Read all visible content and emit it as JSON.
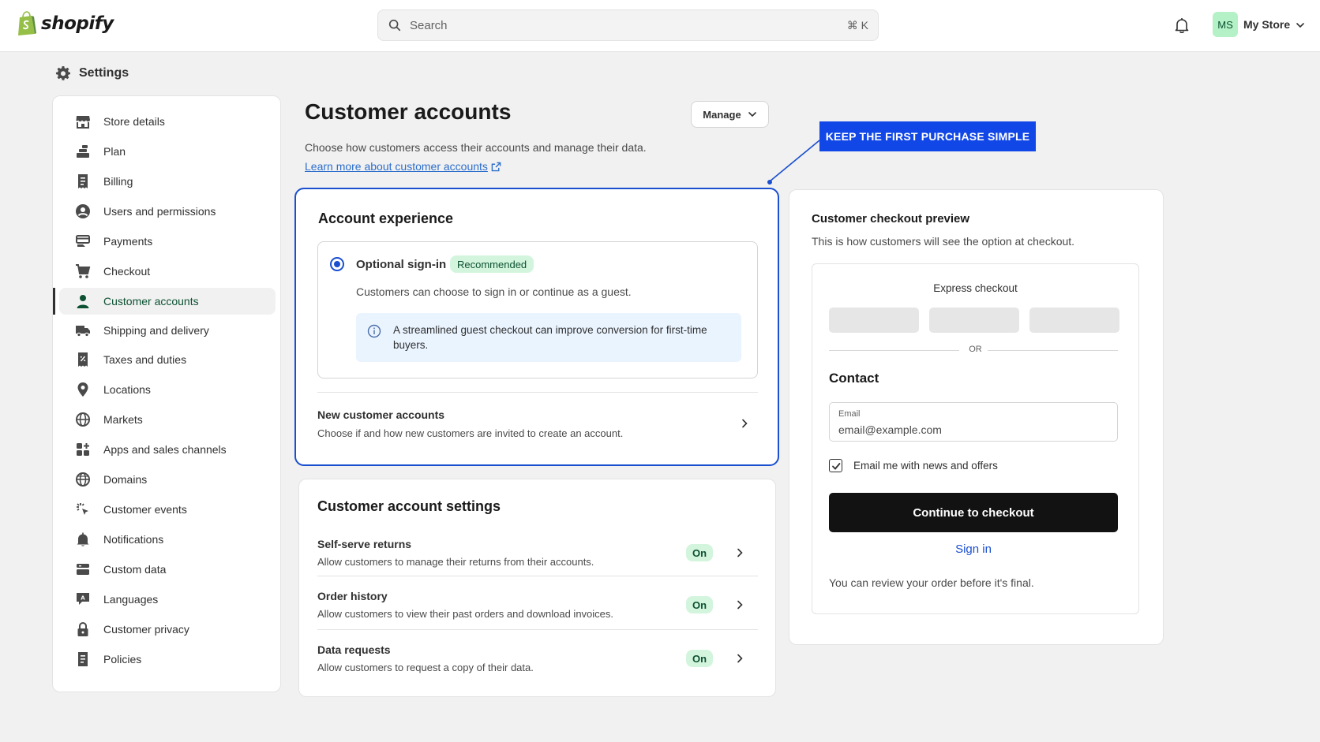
{
  "brand": {
    "name": "shopify"
  },
  "search": {
    "placeholder": "Search",
    "shortcut": "⌘ K"
  },
  "account": {
    "initials": "MS",
    "store_name": "My Store"
  },
  "settings": {
    "title": "Settings"
  },
  "sidebar": {
    "items": [
      {
        "label": "Store details",
        "icon": "store-icon"
      },
      {
        "label": "Plan",
        "icon": "plan-icon"
      },
      {
        "label": "Billing",
        "icon": "receipt-icon"
      },
      {
        "label": "Users and permissions",
        "icon": "user-circle-icon"
      },
      {
        "label": "Payments",
        "icon": "payments-icon"
      },
      {
        "label": "Checkout",
        "icon": "cart-icon"
      },
      {
        "label": "Customer accounts",
        "icon": "person-icon",
        "active": true
      },
      {
        "label": "Shipping and delivery",
        "icon": "truck-icon"
      },
      {
        "label": "Taxes and duties",
        "icon": "tax-icon"
      },
      {
        "label": "Locations",
        "icon": "location-pin-icon"
      },
      {
        "label": "Markets",
        "icon": "globe-icon"
      },
      {
        "label": "Apps and sales channels",
        "icon": "apps-icon"
      },
      {
        "label": "Domains",
        "icon": "domain-globe-icon"
      },
      {
        "label": "Customer events",
        "icon": "cursor-click-icon"
      },
      {
        "label": "Notifications",
        "icon": "bell-icon"
      },
      {
        "label": "Custom data",
        "icon": "database-icon"
      },
      {
        "label": "Languages",
        "icon": "language-icon"
      },
      {
        "label": "Customer privacy",
        "icon": "lock-icon"
      },
      {
        "label": "Policies",
        "icon": "policy-document-icon"
      }
    ]
  },
  "page": {
    "title": "Customer accounts",
    "manage_label": "Manage",
    "description": "Choose how customers access their accounts and manage their data.",
    "learn_link": "Learn more about customer accounts"
  },
  "callout": {
    "text": "KEEP THE FIRST PURCHASE SIMPLE"
  },
  "account_experience": {
    "title": "Account experience",
    "option_label": "Optional sign-in",
    "option_badge": "Recommended",
    "option_desc": "Customers can choose to sign in or continue as a guest.",
    "info_text": "A streamlined guest checkout can improve conversion for first-time buyers.",
    "new_accounts_title": "New customer accounts",
    "new_accounts_desc": "Choose if and how new customers are invited to create an account."
  },
  "account_settings": {
    "title": "Customer account settings",
    "rows": [
      {
        "title": "Self-serve returns",
        "desc": "Allow customers to manage their returns from their accounts.",
        "status": "On"
      },
      {
        "title": "Order history",
        "desc": "Allow customers to view their past orders and download invoices.",
        "status": "On"
      },
      {
        "title": "Data requests",
        "desc": "Allow customers to request a copy of their data.",
        "status": "On"
      }
    ]
  },
  "preview": {
    "title": "Customer checkout preview",
    "desc": "This is how customers will see the option at checkout.",
    "express_label": "Express checkout",
    "or_label": "OR",
    "contact_label": "Contact",
    "email_label": "Email",
    "email_value": "email@example.com",
    "newsletter_label": "Email me with news and offers",
    "newsletter_checked": true,
    "continue_label": "Continue to checkout",
    "signin_label": "Sign in",
    "review_text": "You can review your order before it's final."
  },
  "colors": {
    "accent_blue": "#1a4fd0",
    "callout_blue": "#1147e6",
    "success_bg": "#d4f5dd",
    "success_text": "#0c5132",
    "shopify_green": "#95bf47"
  }
}
